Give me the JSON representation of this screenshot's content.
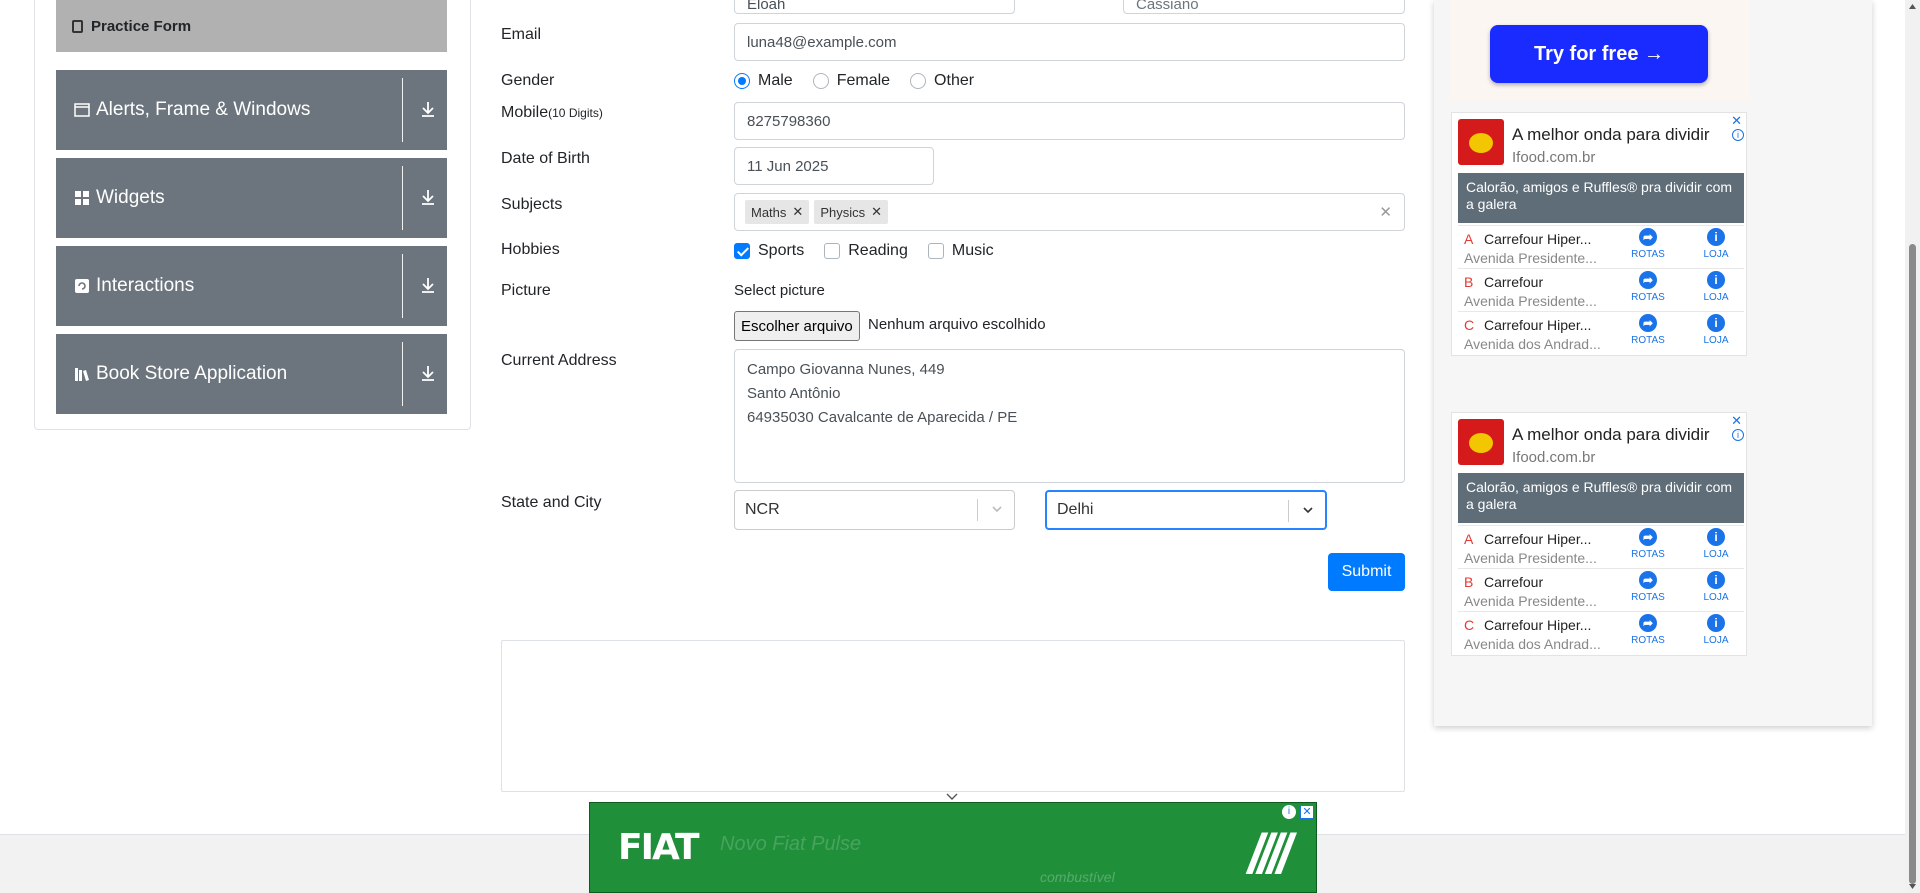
{
  "sidebar": {
    "active_item": "Practice Form",
    "groups": [
      {
        "label": "Alerts, Frame & Windows"
      },
      {
        "label": "Widgets"
      },
      {
        "label": "Interactions"
      },
      {
        "label": "Book Store Application"
      }
    ]
  },
  "form": {
    "first_name": "Eloah",
    "last_name": "Cassiano",
    "email_label": "Email",
    "email_value": "luna48@example.com",
    "gender_label": "Gender",
    "gender_options": [
      "Male",
      "Female",
      "Other"
    ],
    "gender_selected": "Male",
    "mobile_label": "Mobile",
    "mobile_hint": "(10 Digits)",
    "mobile_value": "8275798360",
    "dob_label": "Date of Birth",
    "dob_value": "11 Jun 2025",
    "subjects_label": "Subjects",
    "subjects": [
      "Maths",
      "Physics"
    ],
    "hobbies_label": "Hobbies",
    "hobbies": [
      "Sports",
      "Reading",
      "Music"
    ],
    "hobbies_checked": [
      "Sports"
    ],
    "picture_label": "Picture",
    "select_picture_label": "Select picture",
    "file_button": "Escolher arquivo",
    "file_status": "Nenhum arquivo escolhido",
    "address_label": "Current Address",
    "address_lines": [
      "Campo Giovanna Nunes, 449",
      "Santo Antônio",
      "64935030 Cavalcante de Aparecida / PE"
    ],
    "state_city_label": "State and City",
    "state_value": "NCR",
    "city_value": "Delhi",
    "submit_label": "Submit"
  },
  "ads": {
    "try_button": "Try for free →",
    "cards": [
      {
        "title": "A melhor onda para dividir",
        "domain": "Ifood.com.br",
        "banner": "Calorão, amigos e Ruffles® pra dividir com a galera",
        "rows": [
          {
            "letter": "A",
            "store": "Carrefour Hiper...",
            "address": "Avenida Presidente..."
          },
          {
            "letter": "B",
            "store": "Carrefour",
            "address": "Avenida Presidente..."
          },
          {
            "letter": "C",
            "store": "Carrefour Hiper...",
            "address": "Avenida dos Andrad..."
          }
        ]
      },
      {
        "title": "A melhor onda para dividir",
        "domain": "Ifood.com.br",
        "banner": "Calorão, amigos e Ruffles® pra dividir com a galera",
        "rows": [
          {
            "letter": "A",
            "store": "Carrefour Hiper...",
            "address": "Avenida Presidente..."
          },
          {
            "letter": "B",
            "store": "Carrefour",
            "address": "Avenida Presidente..."
          },
          {
            "letter": "C",
            "store": "Carrefour Hiper...",
            "address": "Avenida dos Andrad..."
          }
        ]
      }
    ],
    "rotas_label": "ROTAS",
    "loja_label": "LOJA",
    "close_glyph": "✕",
    "info_glyph": "i",
    "fiat": {
      "logo": "FIAT",
      "headline": "Novo Fiat Pulse",
      "sub": "combustível",
      "stripes": "////"
    }
  },
  "colors": {
    "sidebar_group": "#6c757d",
    "practice_active": "#b1b1b1",
    "primary": "#007bff",
    "ad_blue": "#1a2bff",
    "fiat_green": "#1f8f3a"
  },
  "icons": {
    "download": "download-icon",
    "chevron": "chevron-down-icon",
    "remove": "remove-chip-icon",
    "clear": "clear-icon"
  }
}
